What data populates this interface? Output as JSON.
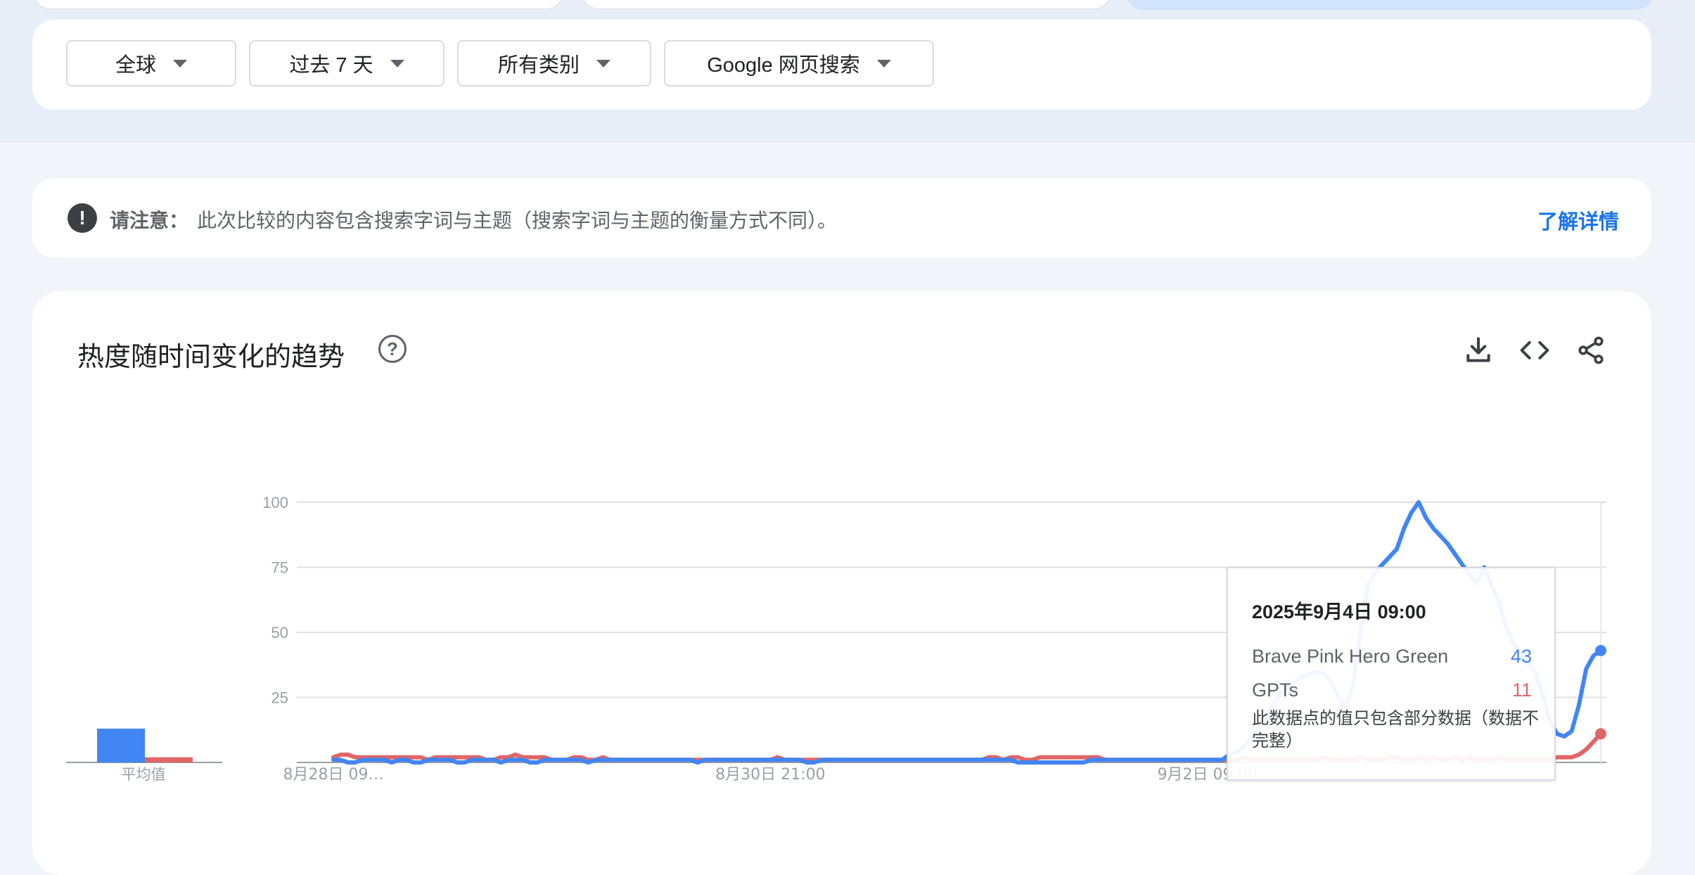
{
  "filters": {
    "region": "全球",
    "time_range": "过去 7 天",
    "category": "所有类别",
    "search_type": "Google 网页搜索"
  },
  "notice": {
    "label": "请注意：",
    "text": "此次比较的内容包含搜索字词与主题（搜索字词与主题的衡量方式不同）。",
    "link": "了解详情"
  },
  "panel": {
    "title": "热度随时间变化的趋势",
    "help_icon": "question-circle-icon",
    "tools": [
      "download-icon",
      "embed-code-icon",
      "share-icon"
    ]
  },
  "colors": {
    "series_blue": "#4285f4",
    "series_red": "#e06666",
    "link": "#1a73e8"
  },
  "chart_data": [
    {
      "type": "bar",
      "categories": [
        "Brave Pink Hero Green",
        "GPTs"
      ],
      "values": [
        13,
        2
      ],
      "xlabel": "平均值",
      "ylim": [
        0,
        100
      ]
    },
    {
      "type": "line",
      "x_tick_labels": [
        "8月28日 09…",
        "8月30日 21:00",
        "9月2日 09:00"
      ],
      "x_tick_index": [
        0,
        60,
        120
      ],
      "ylim": [
        0,
        100
      ],
      "yticks": [
        25,
        50,
        75,
        100
      ],
      "grid": true,
      "series": [
        {
          "name": "Brave Pink Hero Green",
          "color": "#4285f4",
          "values": [
            1,
            1,
            0,
            0,
            1,
            1,
            1,
            1,
            0,
            1,
            1,
            0,
            0,
            1,
            1,
            1,
            1,
            0,
            0,
            1,
            1,
            1,
            1,
            0,
            1,
            1,
            1,
            0,
            0,
            1,
            1,
            1,
            1,
            1,
            1,
            0,
            1,
            1,
            1,
            1,
            1,
            1,
            1,
            1,
            1,
            1,
            1,
            1,
            1,
            1,
            0,
            1,
            1,
            1,
            1,
            1,
            1,
            1,
            1,
            1,
            1,
            1,
            1,
            1,
            1,
            0,
            0,
            1,
            1,
            1,
            1,
            1,
            1,
            1,
            1,
            1,
            1,
            1,
            1,
            1,
            1,
            1,
            1,
            1,
            1,
            1,
            1,
            1,
            1,
            1,
            1,
            1,
            1,
            1,
            0,
            0,
            0,
            0,
            0,
            0,
            0,
            0,
            0,
            0,
            1,
            1,
            1,
            1,
            1,
            1,
            1,
            1,
            1,
            1,
            1,
            1,
            1,
            1,
            1,
            1,
            1,
            1,
            1,
            3,
            4,
            6,
            9,
            13,
            18,
            22,
            26,
            29,
            31,
            33,
            34,
            35,
            34,
            31,
            25,
            21,
            30,
            50,
            68,
            73,
            76,
            79,
            82,
            90,
            96,
            100,
            94,
            90,
            87,
            84,
            80,
            76,
            72,
            69,
            75,
            68,
            62,
            52,
            46,
            42,
            38,
            35,
            26,
            16,
            11,
            10,
            12,
            22,
            36,
            41,
            43
          ]
        },
        {
          "name": "GPTs",
          "color": "#e06666",
          "values": [
            2,
            3,
            3,
            2,
            2,
            2,
            2,
            2,
            2,
            2,
            2,
            2,
            2,
            1,
            2,
            2,
            2,
            2,
            2,
            2,
            2,
            1,
            1,
            2,
            2,
            3,
            2,
            2,
            2,
            2,
            1,
            1,
            1,
            2,
            2,
            1,
            1,
            2,
            1,
            1,
            1,
            1,
            1,
            1,
            1,
            1,
            1,
            1,
            1,
            1,
            1,
            1,
            1,
            1,
            1,
            1,
            1,
            1,
            1,
            1,
            1,
            2,
            1,
            1,
            1,
            1,
            1,
            1,
            1,
            1,
            1,
            1,
            1,
            1,
            1,
            1,
            1,
            1,
            1,
            1,
            1,
            1,
            1,
            1,
            1,
            1,
            1,
            1,
            1,
            1,
            2,
            2,
            1,
            2,
            2,
            1,
            1,
            2,
            2,
            2,
            2,
            2,
            2,
            2,
            2,
            2,
            1,
            1,
            1,
            1,
            1,
            1,
            1,
            1,
            1,
            1,
            1,
            1,
            1,
            1,
            1,
            1,
            1,
            1,
            1,
            2,
            1,
            1,
            1,
            1,
            1,
            1,
            1,
            1,
            1,
            1,
            2,
            1,
            1,
            1,
            1,
            2,
            1,
            1,
            1,
            2,
            2,
            1,
            1,
            2,
            1,
            2,
            1,
            1,
            2,
            1,
            2,
            1,
            1,
            1,
            2,
            1,
            1,
            1,
            1,
            1,
            1,
            1,
            2,
            2,
            2,
            3,
            5,
            8,
            11
          ]
        }
      ]
    }
  ],
  "tooltip": {
    "date": "2025年9月4日 09:00",
    "rows": [
      {
        "name": "Brave Pink Hero Green",
        "value": "43"
      },
      {
        "name": "GPTs",
        "value": "11"
      }
    ],
    "note": "此数据点的值只包含部分数据（数据不完整）"
  }
}
